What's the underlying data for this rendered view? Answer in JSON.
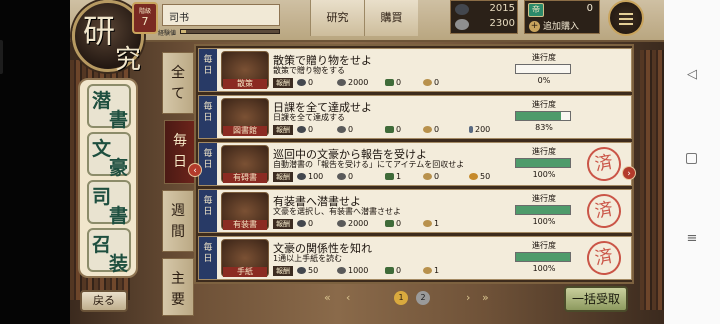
{
  "header": {
    "title_1": "研",
    "title_2": "究",
    "level_label": "階級",
    "level": "7",
    "player_name": "司书",
    "exp_label": "経験値",
    "exp_progress": 0.05,
    "tabs": [
      "研究",
      "購買"
    ],
    "resources": {
      "ink": "2015",
      "coins": "2300"
    },
    "gems": {
      "icon": "帝",
      "count": "0",
      "buy_more_label": "追加購入"
    },
    "menu_icon": "hamburger-menu-icon"
  },
  "categories": [
    {
      "label": "潜書",
      "chars": [
        "潜",
        "書"
      ]
    },
    {
      "label": "文豪",
      "chars": [
        "文",
        "豪"
      ]
    },
    {
      "label": "司書",
      "chars": [
        "司",
        "書"
      ]
    },
    {
      "label": "召装",
      "chars": [
        "召",
        "装"
      ]
    }
  ],
  "back_label": "戻る",
  "period_tabs": [
    {
      "label": "全て",
      "chars": [
        "全",
        "て"
      ],
      "active": false
    },
    {
      "label": "毎日",
      "chars": [
        "毎",
        "日"
      ],
      "active": true
    },
    {
      "label": "週間",
      "chars": [
        "週",
        "間"
      ],
      "active": false
    },
    {
      "label": "主要",
      "chars": [
        "主",
        "要"
      ],
      "active": false
    }
  ],
  "reward_label": "報酬",
  "progress_label": "進行度",
  "completed_stamp": "済",
  "missions": [
    {
      "type": "毎日",
      "type_chars": [
        "毎",
        "日"
      ],
      "tag": "散策",
      "name": "散策で贈り物をせよ",
      "desc": "散策で贈り物をする",
      "rewards": [
        {
          "icon": "ink",
          "value": "0"
        },
        {
          "icon": "coin",
          "value": "2000"
        },
        {
          "icon": "book",
          "value": "0"
        },
        {
          "icon": "medal",
          "value": "0"
        }
      ],
      "progress_pct": 0,
      "progress_text": "0%",
      "completed": false
    },
    {
      "type": "毎日",
      "type_chars": [
        "毎",
        "日"
      ],
      "tag": "図書館",
      "name": "日課を全て達成せよ",
      "desc": "日課を全て達成する",
      "rewards": [
        {
          "icon": "ink",
          "value": "0"
        },
        {
          "icon": "coin",
          "value": "0"
        },
        {
          "icon": "book",
          "value": "0"
        },
        {
          "icon": "medal",
          "value": "0"
        },
        {
          "icon": "pen",
          "value": "200"
        }
      ],
      "progress_pct": 83,
      "progress_text": "83%",
      "completed": false
    },
    {
      "type": "毎日",
      "type_chars": [
        "毎",
        "日"
      ],
      "tag": "有碍書",
      "name": "巡回中の文豪から報告を受けよ",
      "desc": "自動潜書の「報告を受ける」にてアイテムを回収せよ",
      "rewards": [
        {
          "icon": "ink",
          "value": "100"
        },
        {
          "icon": "coin",
          "value": "0"
        },
        {
          "icon": "book",
          "value": "1"
        },
        {
          "icon": "medal",
          "value": "0"
        },
        {
          "icon": "gold",
          "value": "50"
        }
      ],
      "progress_pct": 100,
      "progress_text": "100%",
      "completed": true
    },
    {
      "type": "毎日",
      "type_chars": [
        "毎",
        "日"
      ],
      "tag": "有装書",
      "name": "有装書へ潜書せよ",
      "desc": "文豪を選択し、有装書へ潜書させよ",
      "rewards": [
        {
          "icon": "ink",
          "value": "0"
        },
        {
          "icon": "coin",
          "value": "2000"
        },
        {
          "icon": "book",
          "value": "0"
        },
        {
          "icon": "medal",
          "value": "1"
        }
      ],
      "progress_pct": 100,
      "progress_text": "100%",
      "completed": true
    },
    {
      "type": "毎日",
      "type_chars": [
        "毎",
        "日"
      ],
      "tag": "手紙",
      "name": "文豪の関係性を知れ",
      "desc": "1通以上手紙を読む",
      "rewards": [
        {
          "icon": "ink",
          "value": "50"
        },
        {
          "icon": "coin",
          "value": "1000"
        },
        {
          "icon": "book",
          "value": "0"
        },
        {
          "icon": "medal",
          "value": "1"
        }
      ],
      "progress_pct": 100,
      "progress_text": "100%",
      "completed": true
    }
  ],
  "pager": {
    "pages": [
      "1",
      "2"
    ],
    "current": "1"
  },
  "collect_all_label": "一括受取",
  "colors": {
    "type_bar": "#283a66",
    "progress_fill": "#4e9b6b",
    "stamp": "#c43b2e",
    "active_tab": "#6d241b"
  }
}
